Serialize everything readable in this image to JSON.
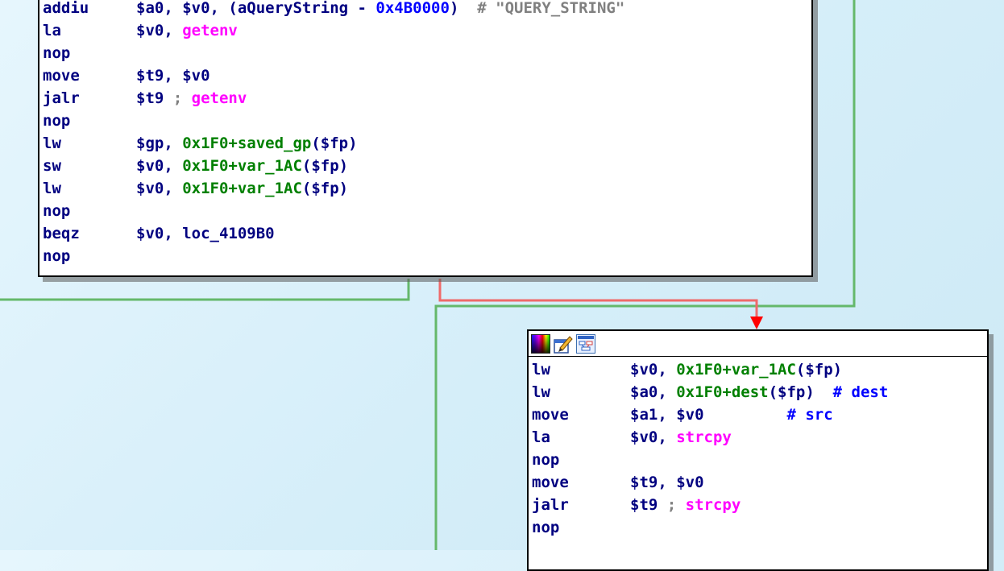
{
  "colors": {
    "edge_true": "#65b86b",
    "edge_false": "#ef6a6a",
    "text_default": "#000080",
    "text_symbol": "#ff00ff",
    "text_var": "#008000",
    "text_num": "#0000ff",
    "text_comment": "#808080"
  },
  "header_icons": [
    "palette-color-icon",
    "edit-pencil-icon",
    "graph-overview-icon"
  ],
  "block_a": {
    "lines": [
      {
        "mnemonic": "addiu",
        "segs": [
          {
            "t": "$a0, $v0, (aQueryString - ",
            "c": "n"
          },
          {
            "t": "0x4B0000",
            "c": "b"
          },
          {
            "t": ")  ",
            "c": "n"
          },
          {
            "t": "# \"QUERY_STRING\"",
            "c": "c"
          }
        ]
      },
      {
        "mnemonic": "la",
        "segs": [
          {
            "t": "$v0, ",
            "c": "n"
          },
          {
            "t": "getenv",
            "c": "m"
          }
        ]
      },
      {
        "mnemonic": "nop",
        "segs": []
      },
      {
        "mnemonic": "move",
        "segs": [
          {
            "t": "$t9, $v0",
            "c": "n"
          }
        ]
      },
      {
        "mnemonic": "jalr",
        "segs": [
          {
            "t": "$t9 ",
            "c": "n"
          },
          {
            "t": "; ",
            "c": "c"
          },
          {
            "t": "getenv",
            "c": "m"
          }
        ]
      },
      {
        "mnemonic": "nop",
        "segs": []
      },
      {
        "mnemonic": "lw",
        "segs": [
          {
            "t": "$gp, ",
            "c": "n"
          },
          {
            "t": "0x1F0+saved_gp",
            "c": "g"
          },
          {
            "t": "($fp)",
            "c": "n"
          }
        ]
      },
      {
        "mnemonic": "sw",
        "segs": [
          {
            "t": "$v0, ",
            "c": "n"
          },
          {
            "t": "0x1F0+var_1AC",
            "c": "g"
          },
          {
            "t": "($fp)",
            "c": "n"
          }
        ]
      },
      {
        "mnemonic": "lw",
        "segs": [
          {
            "t": "$v0, ",
            "c": "n"
          },
          {
            "t": "0x1F0+var_1AC",
            "c": "g"
          },
          {
            "t": "($fp)",
            "c": "n"
          }
        ]
      },
      {
        "mnemonic": "nop",
        "segs": []
      },
      {
        "mnemonic": "beqz",
        "segs": [
          {
            "t": "$v0, loc_4109B0",
            "c": "n"
          }
        ]
      },
      {
        "mnemonic": "nop",
        "segs": []
      }
    ]
  },
  "block_b": {
    "lines": [
      {
        "mnemonic": "lw",
        "segs": [
          {
            "t": "$v0, ",
            "c": "n"
          },
          {
            "t": "0x1F0+var_1AC",
            "c": "g"
          },
          {
            "t": "($fp)",
            "c": "n"
          }
        ]
      },
      {
        "mnemonic": "lw",
        "segs": [
          {
            "t": "$a0, ",
            "c": "n"
          },
          {
            "t": "0x1F0+dest",
            "c": "g"
          },
          {
            "t": "($fp)  ",
            "c": "n"
          },
          {
            "t": "# dest",
            "c": "b"
          }
        ]
      },
      {
        "mnemonic": "move",
        "segs": [
          {
            "t": "$a1, $v0         ",
            "c": "n"
          },
          {
            "t": "# src",
            "c": "b"
          }
        ]
      },
      {
        "mnemonic": "la",
        "segs": [
          {
            "t": "$v0, ",
            "c": "n"
          },
          {
            "t": "strcpy",
            "c": "m"
          }
        ]
      },
      {
        "mnemonic": "nop",
        "segs": []
      },
      {
        "mnemonic": "move",
        "segs": [
          {
            "t": "$t9, $v0",
            "c": "n"
          }
        ]
      },
      {
        "mnemonic": "jalr",
        "segs": [
          {
            "t": "$t9 ",
            "c": "n"
          },
          {
            "t": "; ",
            "c": "c"
          },
          {
            "t": "strcpy",
            "c": "m"
          }
        ]
      },
      {
        "mnemonic": "nop",
        "segs": []
      }
    ]
  }
}
